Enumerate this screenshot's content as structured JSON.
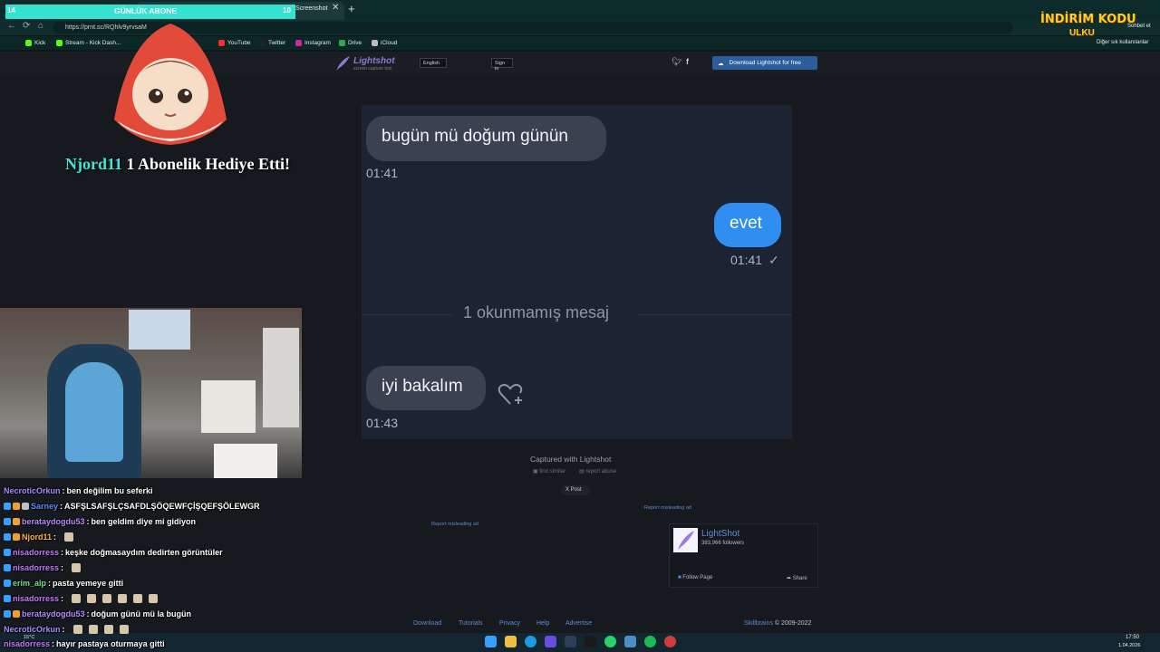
{
  "browser": {
    "tab_title": "Screenshot",
    "url": "https://prnt.sc/RQhlv9yrvsaM",
    "bookmarks": [
      "Kick",
      "Stream - Kick Dash...",
      "YouTube",
      "Twitter",
      "Instagram",
      "Drive",
      "iCloud"
    ],
    "other_bookmarks": "Diğer sık kullanılanlar",
    "chat_button": "Sohbet et"
  },
  "lightshot": {
    "logo": "Lightshot",
    "logo_sub": "screen capture tool",
    "language": "English",
    "sign_in": "Sign in",
    "download_button": "Download Lightshot for free",
    "captured_with": "Captured with Lightshot",
    "find_similar": "find similar",
    "report_abuse": "report abuse",
    "x_post": "X Post",
    "report_misleading": "Report misleading ad",
    "widget": {
      "name": "LightShot",
      "followers": "383,966 followers",
      "follow_page": "Follow Page",
      "share": "Share"
    },
    "footer_links": [
      "Download",
      "Tutorials",
      "Privacy",
      "Help",
      "Advertise"
    ],
    "footer_brand": "Skillbrains",
    "footer_copy": "© 2009-2022"
  },
  "chat_image": {
    "msg1": "bugün mü doğum günün",
    "time1": "01:41",
    "msg2": "evet",
    "time2": "01:41",
    "unread": "1 okunmamış mesaj",
    "msg3": "iyi bakalım",
    "time3": "01:43"
  },
  "overlay": {
    "sub_left": "14",
    "sub_title": "GÜNLÜK ABONE",
    "sub_right": "10",
    "gift_name": "Njord11",
    "gift_text": " 1 Abonelik Hediye Etti!",
    "promo": "İNDİRİM KODU",
    "promo2": "ULKU"
  },
  "stream_chat": [
    {
      "user": "NecroticOrkun",
      "color": "#a98bff",
      "msg": "ben değilim bu seferki"
    },
    {
      "user": "Sarney",
      "color": "#5b8cff",
      "msg": "ASFŞLSAFŞLÇSAFDLŞÖQEWFÇİŞQEFŞÖLEWGR"
    },
    {
      "user": "berataydogdu53",
      "color": "#b58cff",
      "msg": "ben geldim diye mi gidiyon"
    },
    {
      "user": "Njord11",
      "color": "#ffb33a",
      "msg": ""
    },
    {
      "user": "nisadorress",
      "color": "#c778ff",
      "msg": "keşke doğmasaydım dedirten görüntüler"
    },
    {
      "user": "nisadorress",
      "color": "#c778ff",
      "msg": ""
    },
    {
      "user": "erim_alp",
      "color": "#6fe08a",
      "msg": "pasta yemeye gitti"
    },
    {
      "user": "nisadorress",
      "color": "#c778ff",
      "msg": ""
    },
    {
      "user": "berataydogdu53",
      "color": "#b58cff",
      "msg": "doğum günü mü la bugün"
    },
    {
      "user": "NecroticOrkun",
      "color": "#a98bff",
      "msg": ""
    },
    {
      "user": "nisadorress",
      "color": "#c778ff",
      "msg": "hayır pastaya oturmaya gitti"
    }
  ],
  "taskbar": {
    "weather": "15°C",
    "time": "17:50",
    "date": "1.04.2026"
  }
}
